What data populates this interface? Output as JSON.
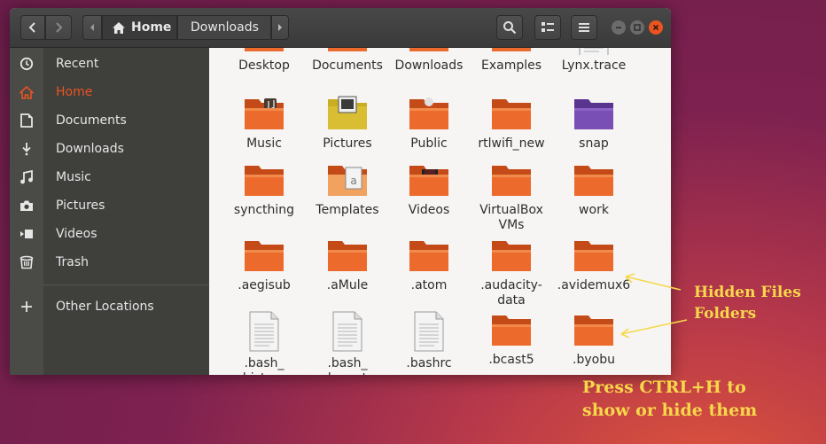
{
  "header": {
    "back_icon": "back-arrow-icon",
    "forward_icon": "forward-arrow-icon",
    "crumbs": [
      "Home",
      "Downloads"
    ],
    "search_icon": "search-icon",
    "view_icon": "list-view-icon",
    "menu_icon": "hamburger-menu-icon"
  },
  "sidebar": {
    "items": [
      {
        "label": "Recent",
        "icon": "clock-icon"
      },
      {
        "label": "Home",
        "icon": "home-icon",
        "active": true
      },
      {
        "label": "Documents",
        "icon": "document-icon"
      },
      {
        "label": "Downloads",
        "icon": "download-icon"
      },
      {
        "label": "Music",
        "icon": "music-icon"
      },
      {
        "label": "Pictures",
        "icon": "camera-icon"
      },
      {
        "label": "Videos",
        "icon": "video-icon"
      },
      {
        "label": "Trash",
        "icon": "trash-icon"
      },
      {
        "label": "Other Locations",
        "icon": "plus-icon"
      }
    ]
  },
  "files": {
    "row0": [
      "Desktop",
      "Documents",
      "Downloads",
      "Examples",
      "Lynx.trace"
    ],
    "row1": [
      "Music",
      "Pictures",
      "Public",
      "rtlwifi_new",
      "snap"
    ],
    "row2": [
      "syncthing",
      "Templates",
      "Videos",
      "VirtualBox\nVMs",
      "work"
    ],
    "row3": [
      ".aegisub",
      ".aMule",
      ".atom",
      ".audacity-\ndata",
      ".avidemux6"
    ],
    "row4": [
      ".bash_\nhistory",
      ".bash_\nlogout",
      ".bashrc",
      ".bcast5",
      ".byobu"
    ]
  },
  "annotations": {
    "hidden_line1": "Hidden Files",
    "hidden_line2": "Folders",
    "shortcut_line1": "Press CTRL+H to",
    "shortcut_line2": "show or hide them"
  },
  "colors": {
    "accent": "#e95420",
    "annotation": "#f7d84a"
  }
}
